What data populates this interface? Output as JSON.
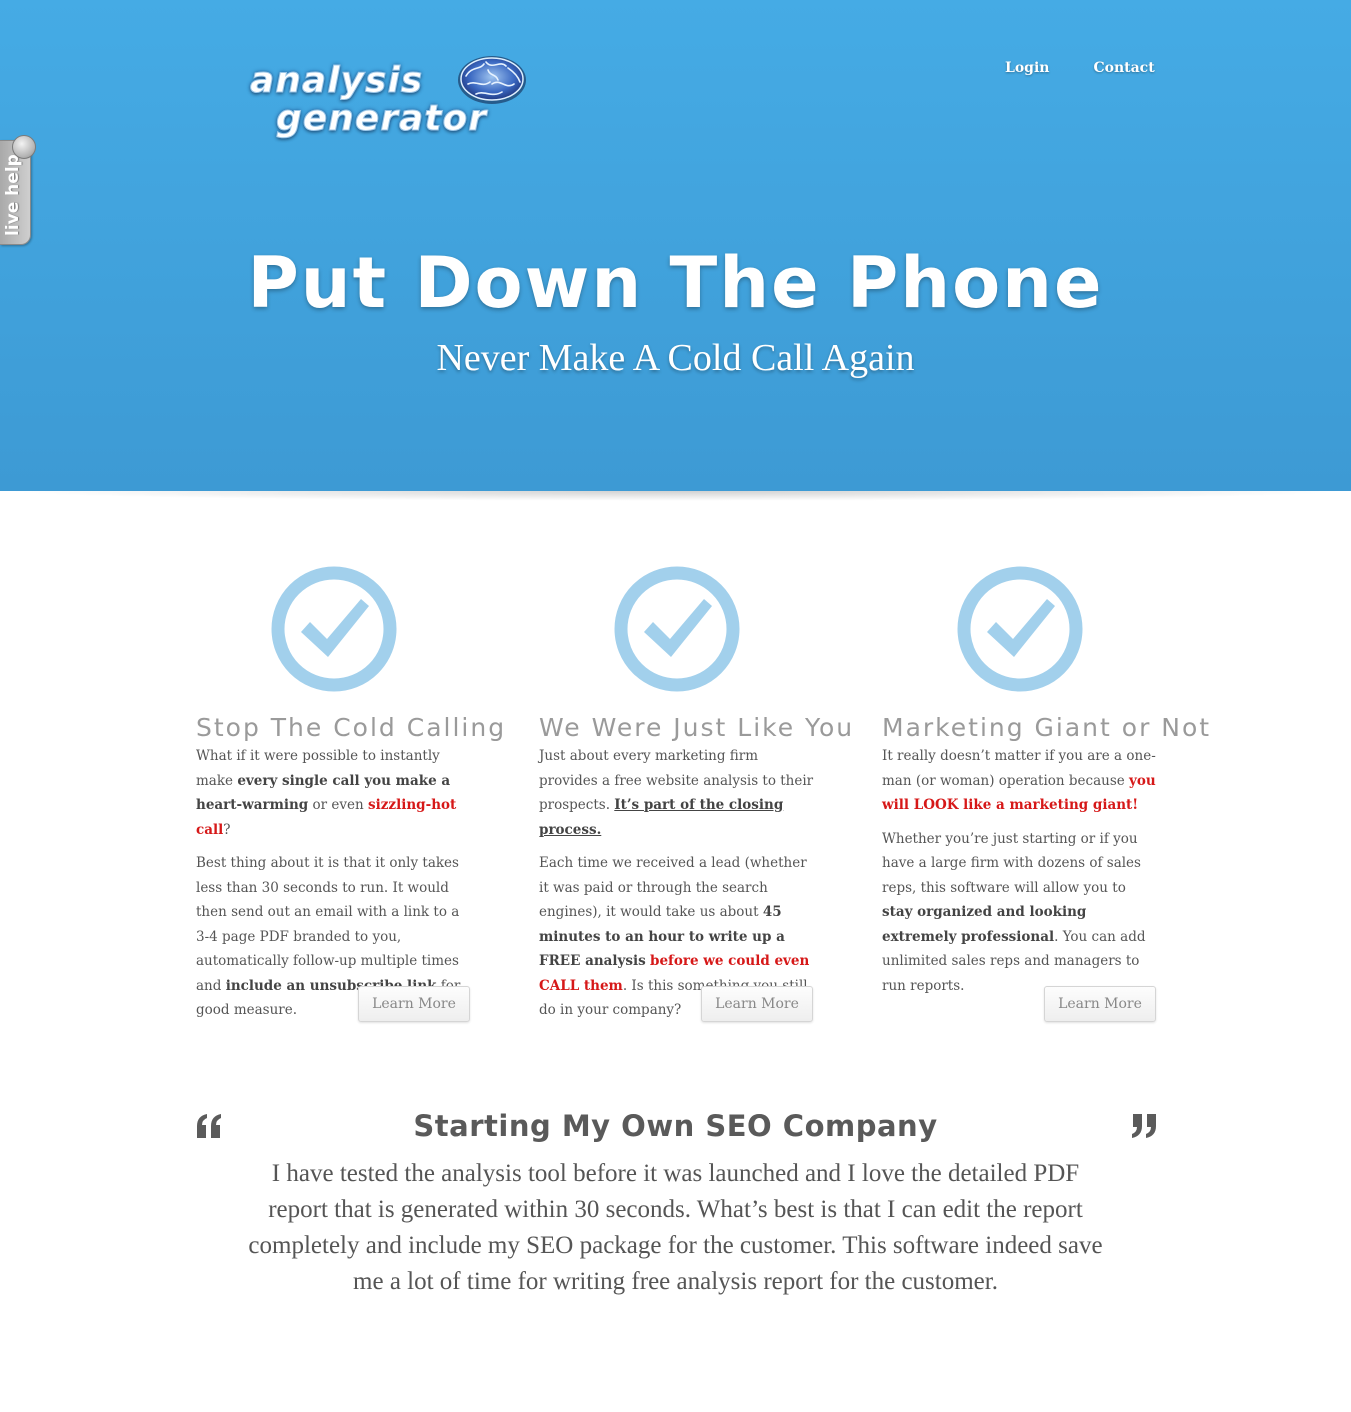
{
  "brand": {
    "line1": "analysis",
    "line2": "generator"
  },
  "nav": {
    "login": "Login",
    "contact": "Contact"
  },
  "live_help": "live help",
  "hero": {
    "title": "Put Down The Phone",
    "subtitle": "Never Make A Cold Call Again"
  },
  "features": [
    {
      "title": "Stop The Cold Calling",
      "p1": [
        {
          "t": "What if it were possible to instantly make ",
          "s": "n"
        },
        {
          "t": "every single call you make a heart-warming",
          "s": "b"
        },
        {
          "t": " or even ",
          "s": "n"
        },
        {
          "t": "sizzling-hot call",
          "s": "r"
        },
        {
          "t": "?",
          "s": "n"
        }
      ],
      "p2": [
        {
          "t": "Best thing about it is that it only takes less than 30 seconds to run. It would then send out an email with a link to a 3-4 page PDF branded to you, automatically follow-up multiple times and ",
          "s": "n"
        },
        {
          "t": "include an unsubscribe link",
          "s": "b"
        },
        {
          "t": " for good measure.",
          "s": "n"
        }
      ],
      "button": "Learn More"
    },
    {
      "title": "We Were Just Like You",
      "p1": [
        {
          "t": "Just about every marketing firm provides a free website analysis to their prospects. ",
          "s": "n"
        },
        {
          "t": "It’s part of the closing process.",
          "s": "u"
        }
      ],
      "p2": [
        {
          "t": "Each time we received a lead (whether it was paid or through the search engines), it would take us about ",
          "s": "n"
        },
        {
          "t": "45 minutes to an hour to write up a FREE analysis",
          "s": "b"
        },
        {
          "t": " ",
          "s": "n"
        },
        {
          "t": "before we could even CALL them",
          "s": "r"
        },
        {
          "t": ". Is this something you still do in your company?",
          "s": "n"
        }
      ],
      "button": "Learn More"
    },
    {
      "title": "Marketing Giant or Not",
      "p1": [
        {
          "t": "It really doesn’t matter if you are a one-man (or woman) operation because ",
          "s": "n"
        },
        {
          "t": "you will LOOK like a marketing giant!",
          "s": "r"
        }
      ],
      "p2": [
        {
          "t": "Whether you’re just starting or if you have a large firm with dozens of sales reps, this software will allow you to ",
          "s": "n"
        },
        {
          "t": "stay organized and looking extremely professional",
          "s": "b"
        },
        {
          "t": ". You can add unlimited sales reps and managers to run reports.",
          "s": "n"
        }
      ],
      "button": "Learn More"
    }
  ],
  "testimonial": {
    "title": "Starting My Own SEO Company",
    "body": "I have tested the analysis tool before it was launched and I love the detailed PDF report that is generated within 30 seconds. What’s best is that I can edit the report completely and include my SEO package for the customer. This software indeed save me a lot of time for writing free analysis report for the customer."
  },
  "colors": {
    "hero_blue": "#45abe5",
    "check_blue": "#a2d0ec",
    "highlight_red": "#d61818",
    "heading_gray": "#9a9a9a"
  },
  "icons": [
    "brain-icon",
    "check-circle-icon",
    "open-quote-icon",
    "close-quote-icon"
  ]
}
